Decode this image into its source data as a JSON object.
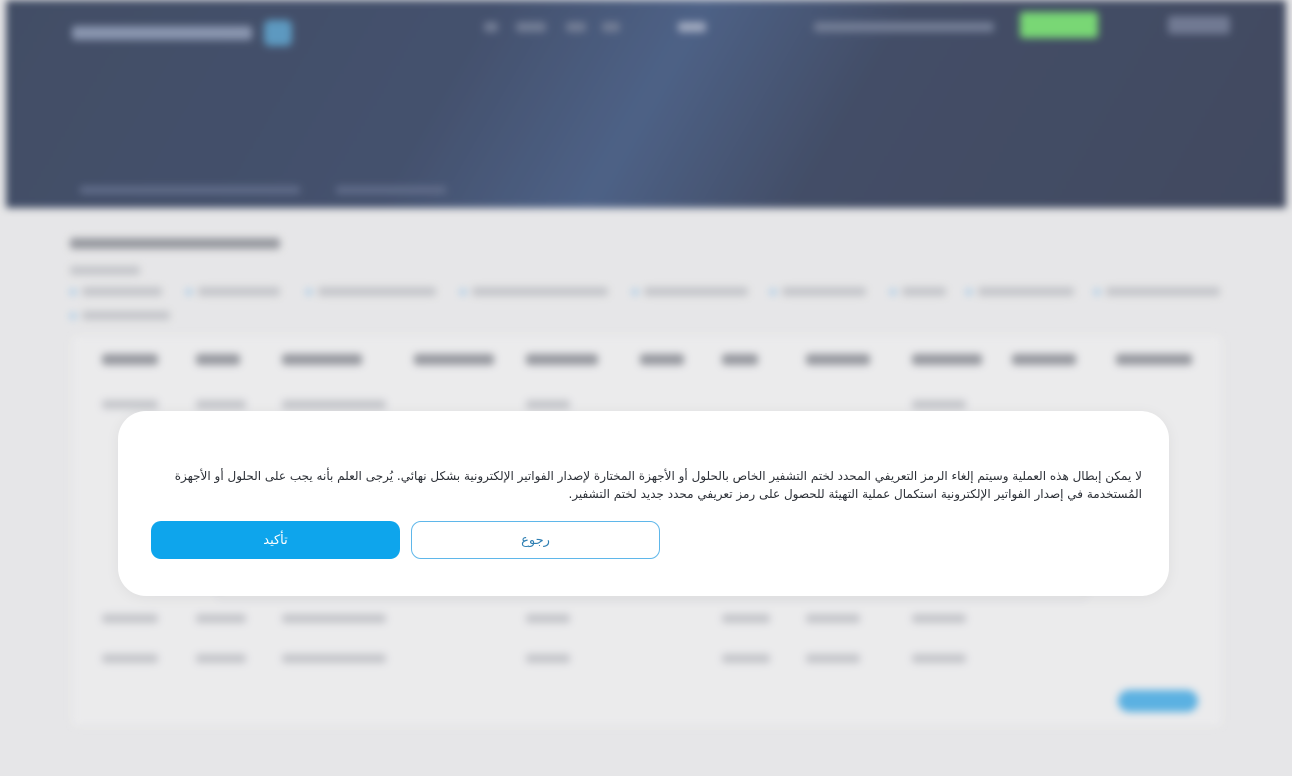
{
  "modal": {
    "message": "لا يمكن إبطال هذه العملية وسيتم إلغاء الرمز التعريفي المحدد لختم التشفير الخاص بالحلول أو الأجهزة المختارة لإصدار الفواتير الإلكترونية بشكل نهائي. يُرجى العلم بأنه يجب على الحلول أو الأجهزة المُستخدمة في إصدار الفواتير الإلكترونية استكمال عملية التهيئة للحصول على رمز تعريفي محدد جديد لختم التشفير.",
    "confirm_label": "تأكيد",
    "back_label": "رجوع"
  },
  "colors": {
    "hero_bg": "#0b1a3a",
    "accent": "#0ea5ec",
    "green_button": "#54d24f"
  }
}
